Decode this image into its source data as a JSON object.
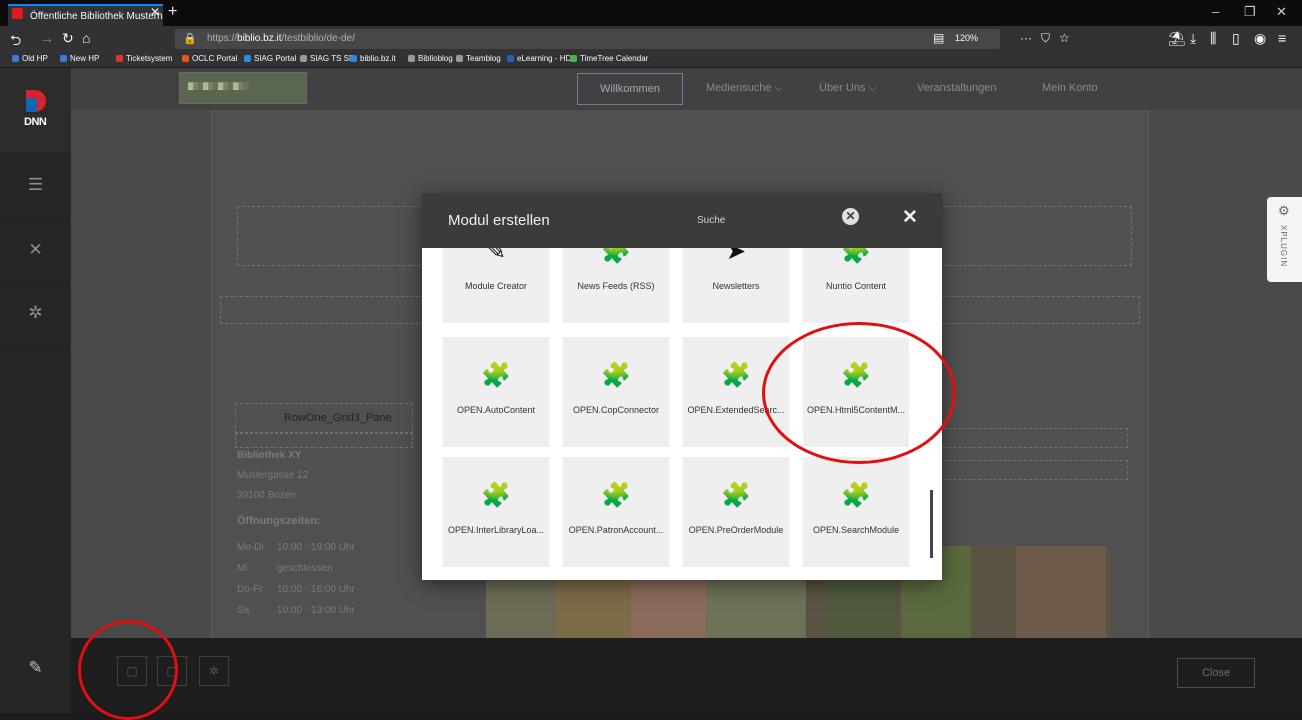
{
  "browser": {
    "tab_title": "Öffentliche Bibliothek Musterh",
    "url_prefix": "https://",
    "url_domain": "biblio.bz.it",
    "url_path": "/testbiblio/de-de/",
    "zoom": "120%",
    "bookmarks": [
      {
        "label": "Old HP",
        "color": "#3a7bd5"
      },
      {
        "label": "New HP",
        "color": "#3a7bd5"
      },
      {
        "label": "Ticketsystem",
        "color": "#d33"
      },
      {
        "label": "OCLC Portal",
        "color": "#e55a1c"
      },
      {
        "label": "SIAG Portal",
        "color": "#2a8de0"
      },
      {
        "label": "SIAG TS SB",
        "color": "#999"
      },
      {
        "label": "biblio.bz.it",
        "color": "#2a8de0"
      },
      {
        "label": "Biblioblog",
        "color": "#999"
      },
      {
        "label": "Teamblog",
        "color": "#999"
      },
      {
        "label": "eLearning - HDS",
        "color": "#2a5fbd"
      },
      {
        "label": "TimeTree Calendar",
        "color": "#4caf50"
      }
    ]
  },
  "dnn": {
    "logo_text": "DNN"
  },
  "site": {
    "menu": [
      "Willkommen",
      "Mediensuche ⌵",
      "Über Uns ⌵",
      "Veranstaltungen",
      "Mein Konto"
    ],
    "pane_label": "RowOne_Grid3_Pane",
    "library_name": "Bibliothek XY",
    "street": "Mustergasse 12",
    "city": "39100 Bozen",
    "hours_title": "Öffnungszeiten:",
    "hours": [
      {
        "day": "Mo-Di",
        "time": "10:00 - 19:00 Uhr"
      },
      {
        "day": "Mi",
        "time": "geschlossen"
      },
      {
        "day": "Do-Fr",
        "time": "10:00 - 16:00 Uhr"
      },
      {
        "day": "Sa",
        "time": "10:00 - 13:00 Uhr"
      }
    ]
  },
  "xplugin_label": "XPLUGIN",
  "toolbar": {
    "close_label": "Close"
  },
  "modal": {
    "title": "Modul erstellen",
    "search_label": "Suche",
    "modules": [
      {
        "label": "Module Creator",
        "icon": "edit-icon"
      },
      {
        "label": "News Feeds (RSS)",
        "icon": "puzzle-icon"
      },
      {
        "label": "Newsletters",
        "icon": "send-icon"
      },
      {
        "label": "Nuntio Content",
        "icon": "puzzle-icon"
      },
      {
        "label": "OPEN.AutoContent",
        "icon": "puzzle-icon"
      },
      {
        "label": "OPEN.CopConnector",
        "icon": "puzzle-icon"
      },
      {
        "label": "OPEN.ExtendedSearc...",
        "icon": "puzzle-icon"
      },
      {
        "label": "OPEN.Html5ContentM...",
        "icon": "puzzle-icon"
      },
      {
        "label": "OPEN.InterLibraryLoa...",
        "icon": "puzzle-icon"
      },
      {
        "label": "OPEN.PatronAccount...",
        "icon": "puzzle-icon"
      },
      {
        "label": "OPEN.PreOrderModule",
        "icon": "puzzle-icon"
      },
      {
        "label": "OPEN.SearchModule",
        "icon": "puzzle-icon"
      }
    ]
  }
}
